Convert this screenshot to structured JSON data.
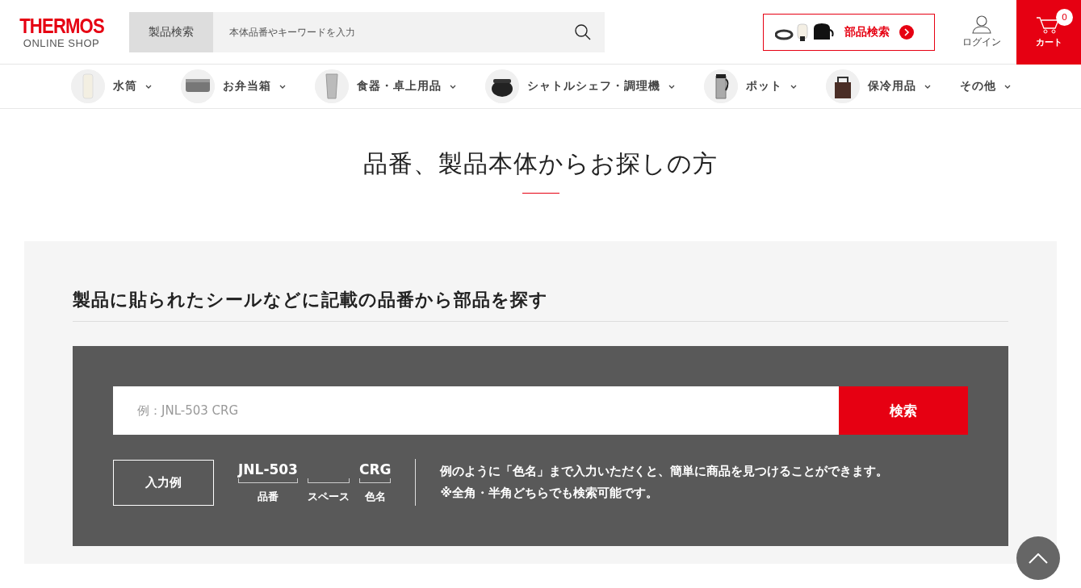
{
  "header": {
    "logo": {
      "brand": "THERMOS",
      "sub": "ONLINE SHOP"
    },
    "search": {
      "tab": "製品検索",
      "placeholder": "本体品番やキーワードを入力"
    },
    "parts_button": {
      "label": "部品検索"
    },
    "login": {
      "label": "ログイン"
    },
    "cart": {
      "label": "カート",
      "count": "0"
    }
  },
  "nav": [
    {
      "label": "水筒",
      "kind": "bottle",
      "expandable": true
    },
    {
      "label": "お弁当箱",
      "kind": "lunchbox",
      "expandable": true
    },
    {
      "label": "食器・卓上用品",
      "kind": "tumbler",
      "expandable": true
    },
    {
      "label": "シャトルシェフ・調理機",
      "kind": "pot",
      "expandable": true
    },
    {
      "label": "ポット",
      "kind": "carafe",
      "expandable": true
    },
    {
      "label": "保冷用品",
      "kind": "bag",
      "expandable": true
    },
    {
      "label": "その他",
      "kind": "text",
      "expandable": true
    }
  ],
  "title": "品番、製品本体からお探しの方",
  "section": {
    "heading": "製品に貼られたシールなどに記載の品番から部品を探す",
    "search": {
      "placeholder": "例：JNL-503 CRG",
      "button": "検索"
    },
    "example": {
      "label": "入力例",
      "parts": [
        {
          "text": "JNL-503",
          "caption": "品番"
        },
        {
          "caption": "スペース"
        },
        {
          "text": "CRG",
          "caption": "色名"
        }
      ],
      "notes": [
        "例のように「色名」まで入力いただくと、簡単に商品を見つけることができます。",
        "※全角・半角どちらでも検索可能です。"
      ]
    }
  }
}
